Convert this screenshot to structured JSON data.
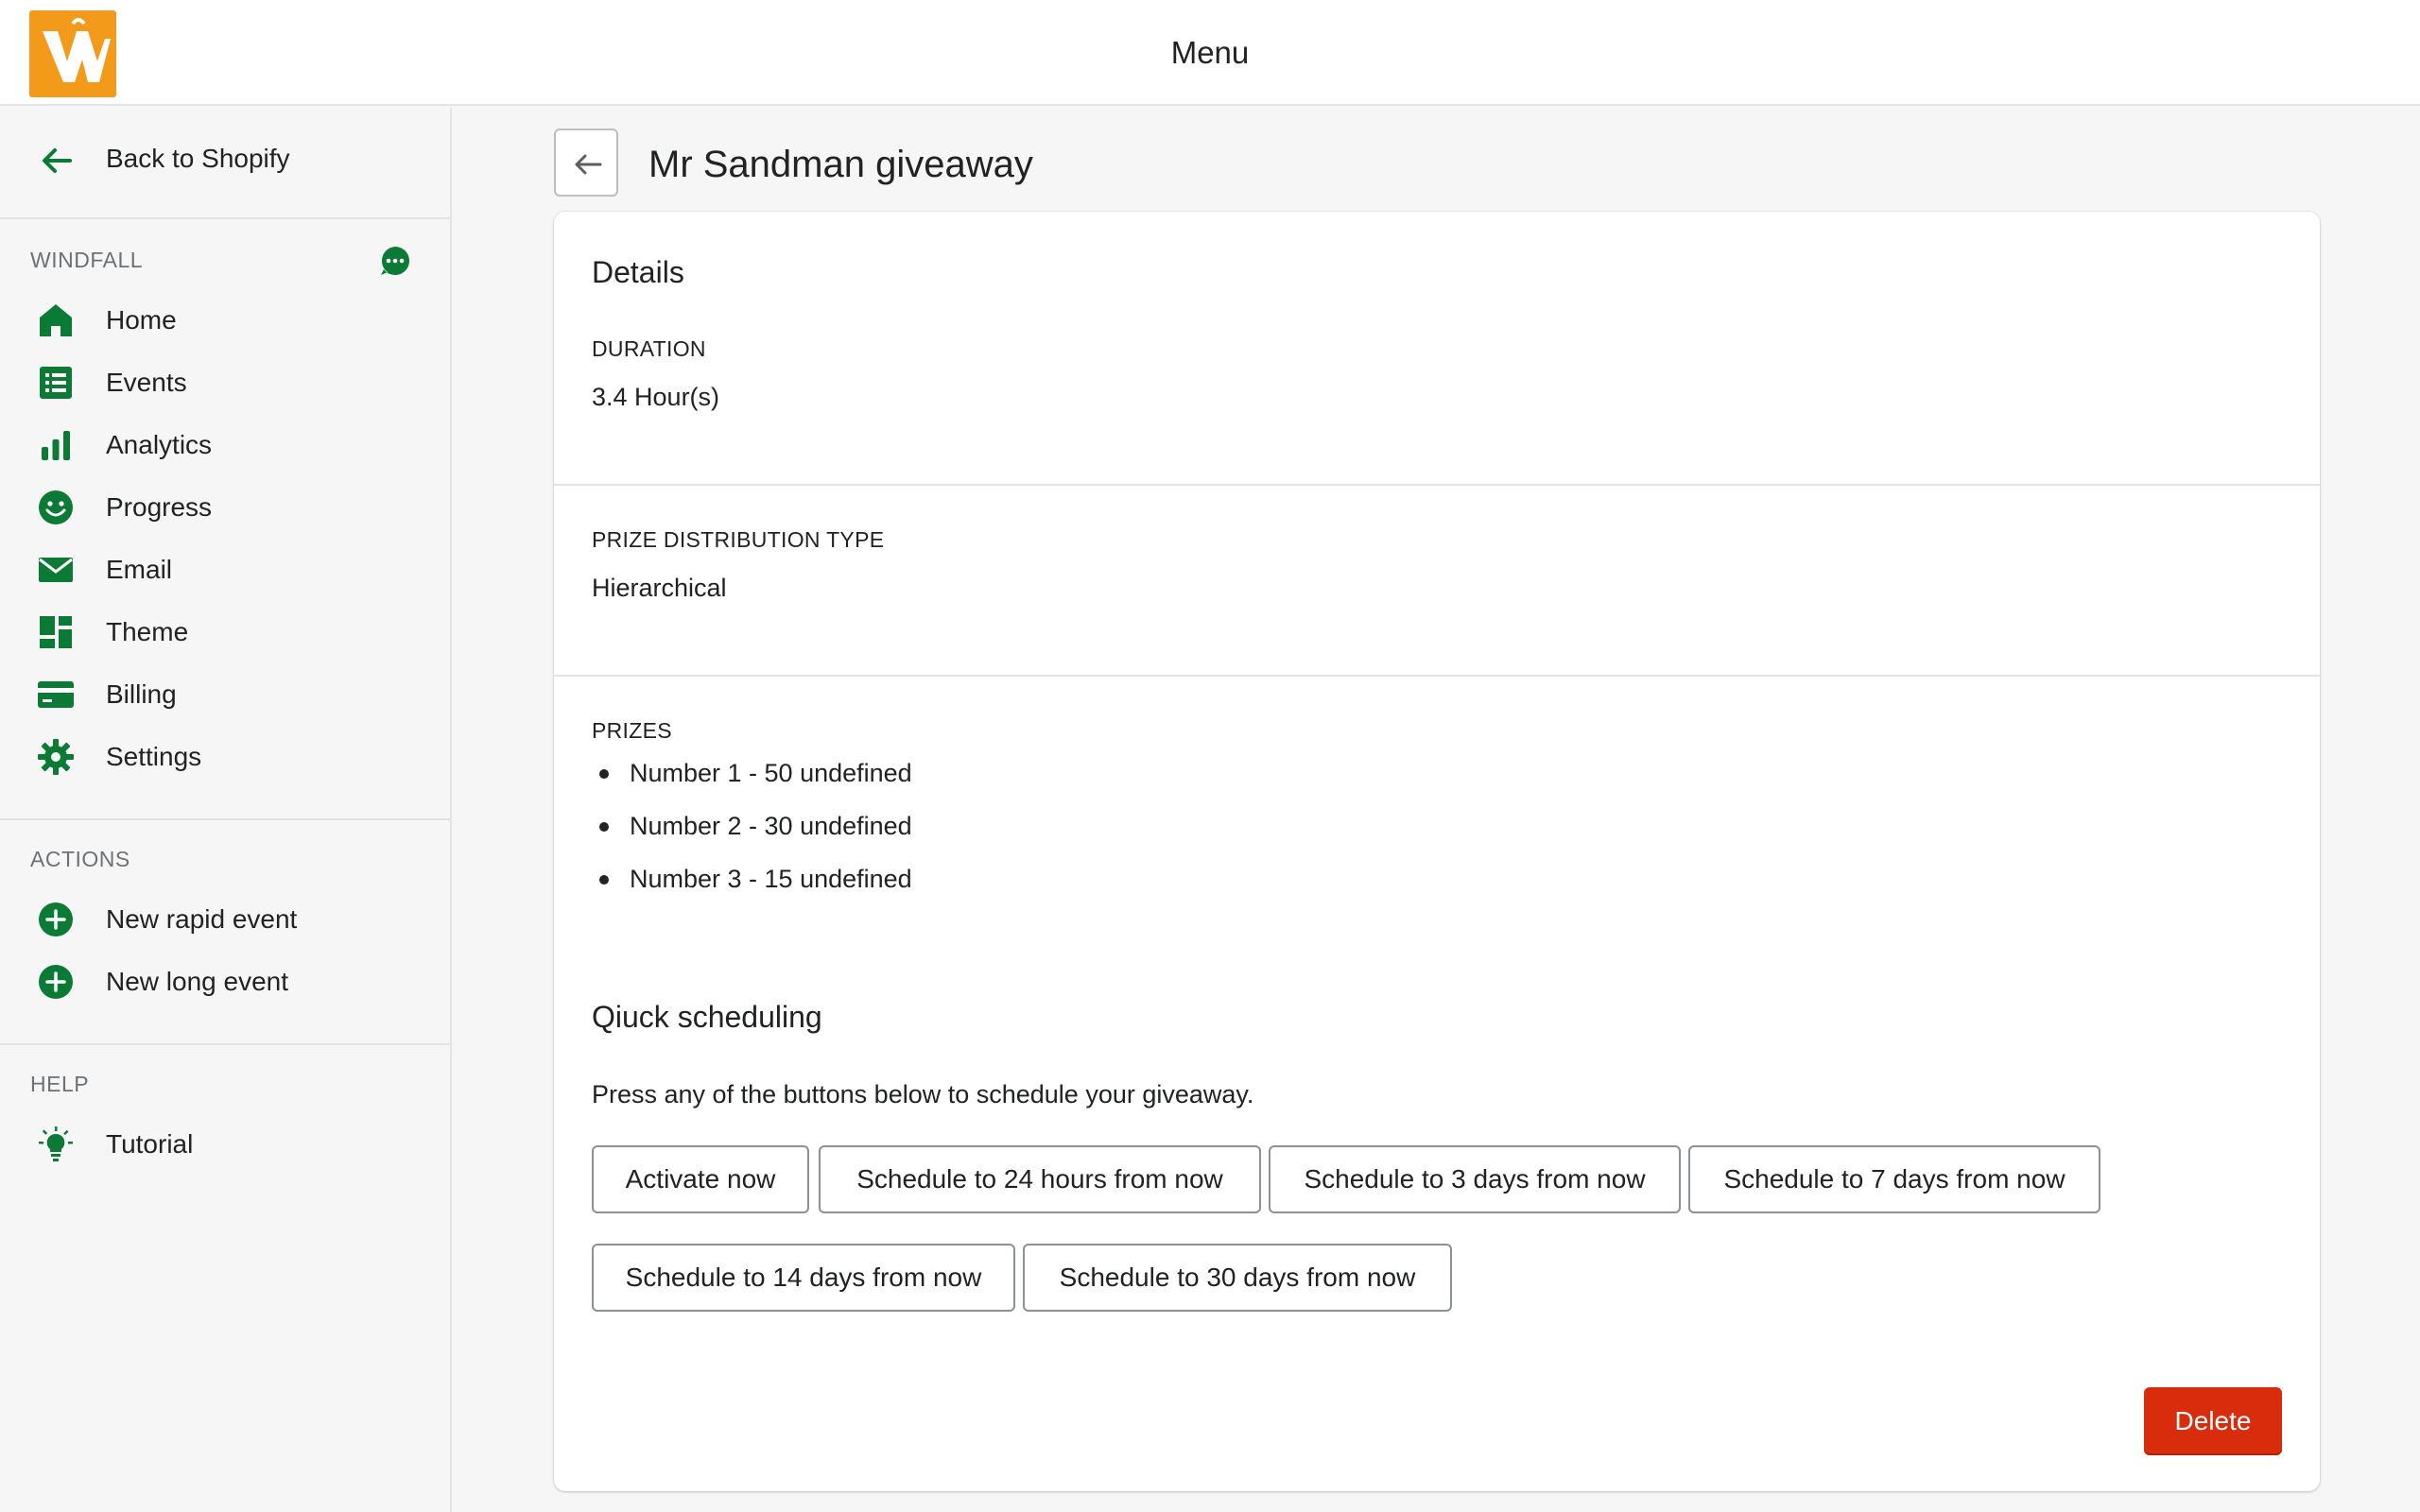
{
  "colors": {
    "accent_green": "#0b7a35",
    "brand_orange": "#f49a1a",
    "danger_red": "#d82c0d"
  },
  "topbar": {
    "logo_icon": "windfall-logo",
    "title": "Menu"
  },
  "sidebar": {
    "back_label": "Back to Shopify",
    "section_windfall": "WINDFALL",
    "chat_icon": "chat-bubble-icon",
    "items": [
      {
        "label": "Home",
        "icon": "home-icon"
      },
      {
        "label": "Events",
        "icon": "list-icon"
      },
      {
        "label": "Analytics",
        "icon": "bar-chart-icon"
      },
      {
        "label": "Progress",
        "icon": "smiley-icon"
      },
      {
        "label": "Email",
        "icon": "envelope-icon"
      },
      {
        "label": "Theme",
        "icon": "layout-icon"
      },
      {
        "label": "Billing",
        "icon": "credit-card-icon"
      },
      {
        "label": "Settings",
        "icon": "gear-icon"
      }
    ],
    "section_actions": "ACTIONS",
    "actions": [
      {
        "label": "New rapid event",
        "icon": "plus-circle-icon"
      },
      {
        "label": "New long event",
        "icon": "plus-circle-icon"
      }
    ],
    "section_help": "HELP",
    "help": [
      {
        "label": "Tutorial",
        "icon": "lightbulb-icon"
      }
    ]
  },
  "page": {
    "title": "Mr Sandman giveaway",
    "details_heading": "Details",
    "duration_label": "DURATION",
    "duration_value": "3.4 Hour(s)",
    "prize_type_label": "PRIZE DISTRIBUTION TYPE",
    "prize_type_value": "Hierarchical",
    "prizes_label": "PRIZES",
    "prizes": [
      "Number 1 - 50 undefined",
      "Number 2 - 30 undefined",
      "Number 3 - 15 undefined"
    ],
    "scheduling_heading": "Qiuck scheduling",
    "scheduling_desc": "Press any of the buttons below to schedule your giveaway.",
    "schedule_buttons": [
      "Activate now",
      "Schedule to 24 hours from now",
      "Schedule to 3 days from now",
      "Schedule to 7 days from now",
      "Schedule to 14 days from now",
      "Schedule to 30 days from now"
    ],
    "delete_label": "Delete"
  }
}
